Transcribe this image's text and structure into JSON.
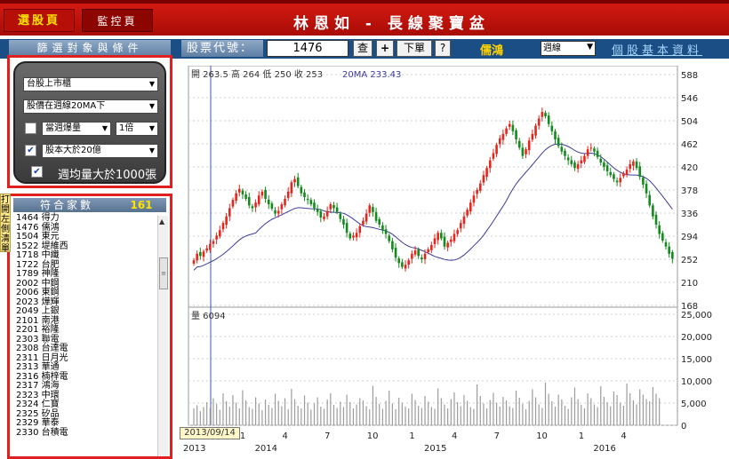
{
  "top_tabs": {
    "pick": "選股頁",
    "monitor": "監控頁"
  },
  "app_title": "林恩如 - 長線聚寶盆",
  "header": {
    "filter_title": "篩選對象與條件",
    "code_label": "股票代號：",
    "code_value": "1476",
    "btn_search": "查",
    "btn_add": "+",
    "btn_order": "下單",
    "btn_help": "?",
    "stock_name": "儒鴻",
    "period_value": "週線",
    "basic_link": "個股基本資料"
  },
  "filter": {
    "market": "台股上市櫃",
    "price_condition": "股價在週線20MA下",
    "vol_checked": false,
    "vol_condition": "當週爆量",
    "vol_multiple": "1倍",
    "cap_checked": true,
    "cap_condition": "股本大於20億",
    "avgvol_checked": true,
    "avgvol_label": "週均量大於1000張"
  },
  "results": {
    "label": "符合家數",
    "count": "161",
    "items": [
      "1464 得力",
      "1476 儒鴻",
      "1504 東元",
      "1522 堤維西",
      "1718 中纖",
      "1722 台肥",
      "1789 神隆",
      "2002 中鋼",
      "2006 東鋼",
      "2023 燁輝",
      "2049 上銀",
      "2101 南港",
      "2201 裕隆",
      "2303 聯電",
      "2308 台達電",
      "2311 日月光",
      "2313 華通",
      "2316 楠梓電",
      "2317 鴻海",
      "2323 中環",
      "2324 仁寶",
      "2325 矽品",
      "2329 華泰",
      "2330 台積電"
    ]
  },
  "side_tab": "打開左側清單",
  "chart_data": {
    "type": "candlestick",
    "ohlc_label": "開 263.5 高 264 低 250 收 253",
    "ma_label": "20MA 233.43",
    "volume_label": "量 6094",
    "price_ticks": [
      588,
      546,
      504,
      462,
      420,
      378,
      336,
      294,
      252,
      210,
      168
    ],
    "volume_ticks": [
      "25,000",
      "20,000",
      "15,000",
      "10,000",
      "5,000",
      "0"
    ],
    "ylim_price": [
      168,
      588
    ],
    "ylim_volume": [
      0,
      25000
    ],
    "x_month_labels": [
      {
        "label": "1",
        "week": 15
      },
      {
        "label": "4",
        "week": 28
      },
      {
        "label": "7",
        "week": 41
      },
      {
        "label": "10",
        "week": 54
      },
      {
        "label": "1",
        "week": 67
      },
      {
        "label": "4",
        "week": 80
      },
      {
        "label": "7",
        "week": 93
      },
      {
        "label": "10",
        "week": 106
      },
      {
        "label": "1",
        "week": 119
      },
      {
        "label": "4",
        "week": 132
      }
    ],
    "x_year_labels": [
      {
        "label": "2013",
        "week": 0
      },
      {
        "label": "2014",
        "week": 22
      },
      {
        "label": "2015",
        "week": 74
      },
      {
        "label": "2016",
        "week": 126
      }
    ],
    "cursor_date": "2013/09/14",
    "up_color": "#e8251c",
    "down_color": "#138a1c",
    "ma_color": "#3b3b9c",
    "closes": [
      250,
      262,
      258,
      266,
      272,
      280,
      285,
      295,
      305,
      318,
      330,
      345,
      360,
      372,
      380,
      370,
      362,
      350,
      345,
      355,
      368,
      375,
      362,
      352,
      344,
      335,
      340,
      352,
      362,
      375,
      392,
      398,
      385,
      372,
      365,
      360,
      352,
      345,
      338,
      328,
      330,
      340,
      352,
      345,
      338,
      325,
      315,
      300,
      290,
      295,
      300,
      312,
      322,
      335,
      350,
      338,
      322,
      315,
      305,
      298,
      285,
      270,
      255,
      245,
      238,
      242,
      250,
      262,
      268,
      258,
      252,
      262,
      270,
      278,
      290,
      300,
      290,
      275,
      282,
      288,
      298,
      305,
      318,
      330,
      342,
      355,
      368,
      378,
      390,
      405,
      418,
      432,
      445,
      460,
      472,
      480,
      490,
      498,
      485,
      470,
      455,
      440,
      452,
      468,
      480,
      495,
      508,
      520,
      512,
      498,
      485,
      470,
      458,
      448,
      440,
      432,
      425,
      418,
      425,
      432,
      440,
      452,
      455,
      448,
      438,
      428,
      420,
      412,
      405,
      398,
      392,
      400,
      408,
      415,
      425,
      430,
      418,
      402,
      388,
      372,
      350,
      330,
      315,
      298,
      286,
      275,
      262,
      253
    ],
    "volumes": [
      3800,
      4500,
      3200,
      4100,
      5200,
      3900,
      6100,
      4800,
      3500,
      7200,
      5400,
      4200,
      6800,
      5100,
      3800,
      7900,
      5600,
      4100,
      3700,
      6300,
      4900,
      3400,
      5800,
      4600,
      3900,
      7100,
      5500,
      4300,
      6100,
      3600,
      8200,
      5900,
      4400,
      3800,
      6700,
      5100,
      3500,
      4900,
      6300,
      4200,
      3700,
      5800,
      7200,
      4600,
      3900,
      5300,
      4100,
      6900,
      5200,
      3800,
      4700,
      6100,
      5600,
      4300,
      3600,
      8900,
      6400,
      4800,
      3700,
      5500,
      7800,
      4900,
      3600,
      6200,
      5100,
      4200,
      3800,
      7100,
      5700,
      4400,
      3900,
      6600,
      5300,
      4100,
      3700,
      8300,
      6100,
      4700,
      3800,
      5900,
      7400,
      5200,
      4300,
      6800,
      5500,
      4100,
      3700,
      9200,
      6600,
      4900,
      3800,
      5700,
      7300,
      5100,
      4200,
      6400,
      5600,
      4300,
      3900,
      7800,
      6200,
      4800,
      3600,
      5500,
      8100,
      6300,
      4700,
      3900,
      9600,
      7100,
      5400,
      4200,
      6900,
      5800,
      4400,
      3700,
      6300,
      8500,
      5900,
      4600,
      3800,
      7200,
      6100,
      4700,
      4100,
      8800,
      6400,
      5200,
      4300,
      7600,
      6800,
      5100,
      4400,
      9400,
      7200,
      5600,
      4700,
      8100,
      6900,
      5900,
      5400,
      8600,
      7100,
      6094
    ]
  }
}
